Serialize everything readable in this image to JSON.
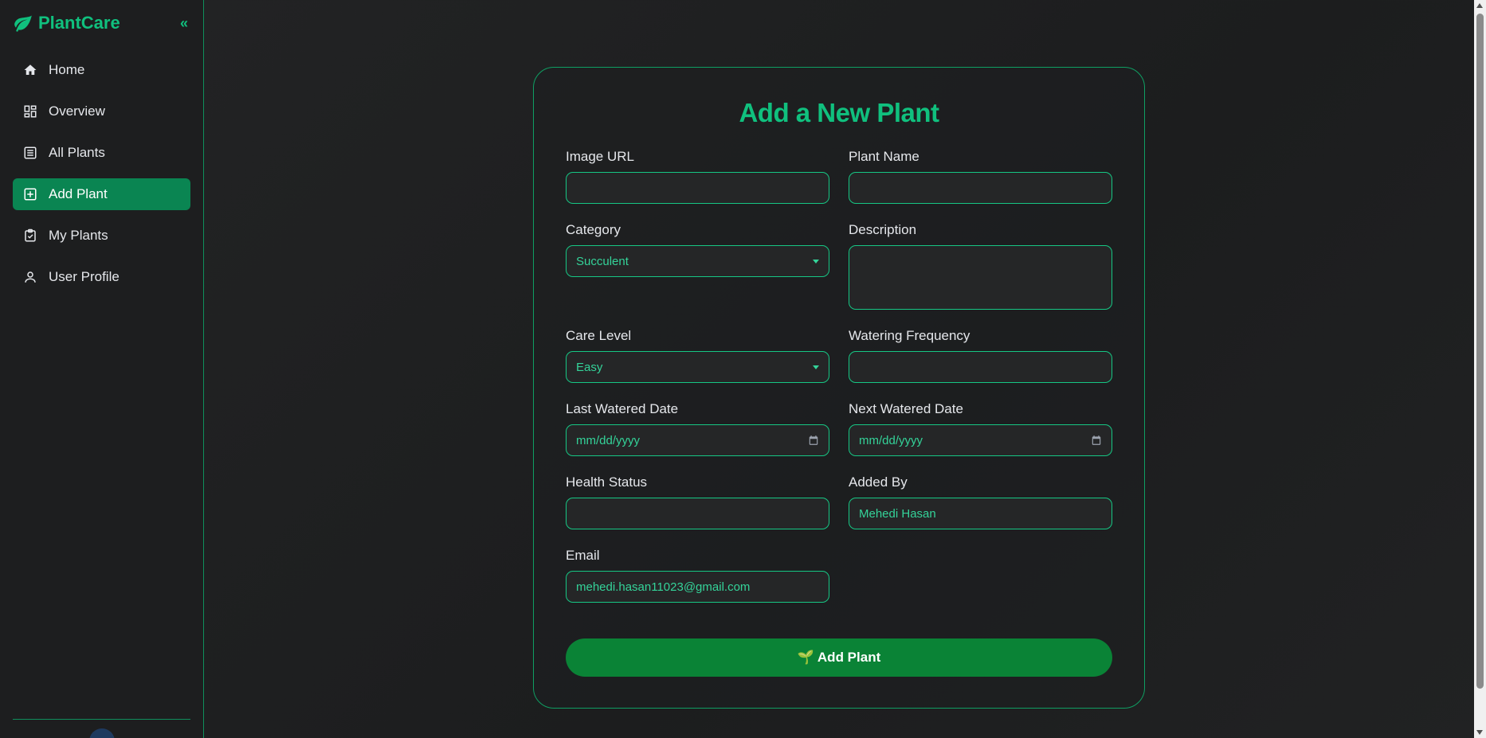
{
  "brand": {
    "name": "PlantCare",
    "collapse_icon": "«"
  },
  "sidebar": {
    "items": [
      {
        "label": "Home",
        "icon": "home-icon",
        "active": false
      },
      {
        "label": "Overview",
        "icon": "dashboard-icon",
        "active": false
      },
      {
        "label": "All Plants",
        "icon": "list-icon",
        "active": false
      },
      {
        "label": "Add Plant",
        "icon": "add-box-icon",
        "active": true
      },
      {
        "label": "My Plants",
        "icon": "clipboard-check-icon",
        "active": false
      },
      {
        "label": "User Profile",
        "icon": "user-icon",
        "active": false
      }
    ]
  },
  "form": {
    "title": "Add a New Plant",
    "image_url": {
      "label": "Image URL",
      "value": ""
    },
    "plant_name": {
      "label": "Plant Name",
      "value": ""
    },
    "category": {
      "label": "Category",
      "value": "Succulent"
    },
    "description": {
      "label": "Description",
      "value": ""
    },
    "care_level": {
      "label": "Care Level",
      "value": "Easy"
    },
    "watering_frequency": {
      "label": "Watering Frequency",
      "value": ""
    },
    "last_watered": {
      "label": "Last Watered Date",
      "placeholder": "mm/dd/yyyy"
    },
    "next_watered": {
      "label": "Next Watered Date",
      "placeholder": "mm/dd/yyyy"
    },
    "health_status": {
      "label": "Health Status",
      "value": ""
    },
    "added_by": {
      "label": "Added By",
      "value": "Mehedi Hasan"
    },
    "email": {
      "label": "Email",
      "value": "mehedi.hasan11023@gmail.com"
    },
    "submit": {
      "emoji": "🌱",
      "label": "Add Plant"
    }
  },
  "colors": {
    "accent": "#10c07e",
    "active_nav": "#0a8552",
    "submit_button": "#0a8336",
    "input_border": "#16c784"
  }
}
